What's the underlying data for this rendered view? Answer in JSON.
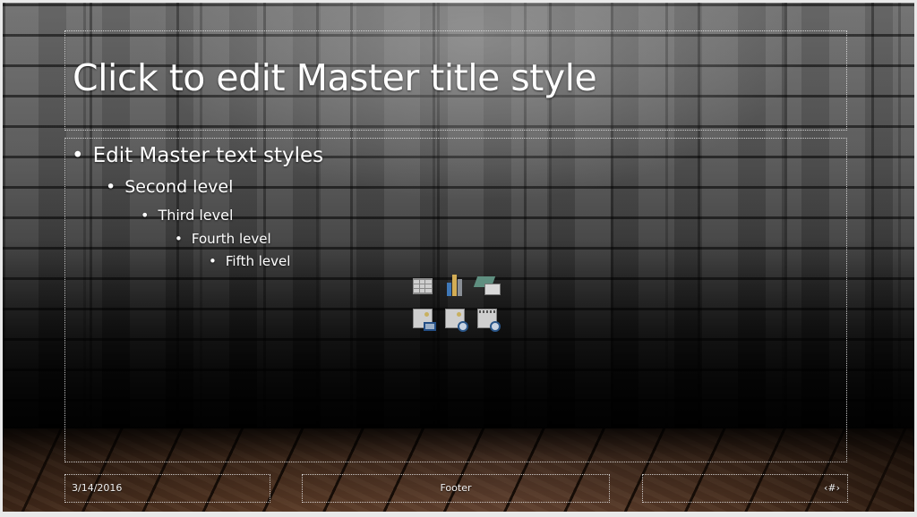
{
  "slide": {
    "title": "Click to edit Master title style",
    "body_levels": [
      {
        "bullet": "•",
        "text": "Edit Master text styles"
      },
      {
        "bullet": "•",
        "text": "Second level"
      },
      {
        "bullet": "•",
        "text": "Third level"
      },
      {
        "bullet": "•",
        "text": "Fourth level"
      },
      {
        "bullet": "•",
        "text": "Fifth level"
      }
    ],
    "content_icons": [
      {
        "name": "insert-table-icon"
      },
      {
        "name": "insert-chart-icon"
      },
      {
        "name": "insert-smartart-icon"
      },
      {
        "name": "insert-picture-icon"
      },
      {
        "name": "insert-online-picture-icon"
      },
      {
        "name": "insert-video-icon"
      }
    ],
    "footer": {
      "date": "3/14/2016",
      "center": "Footer",
      "slide_number": "‹#›"
    },
    "colors": {
      "text": "#ffffff",
      "chart_blue": "#3f78b8",
      "chart_gold": "#d3ad55",
      "chart_gray": "#8a8f96"
    }
  }
}
